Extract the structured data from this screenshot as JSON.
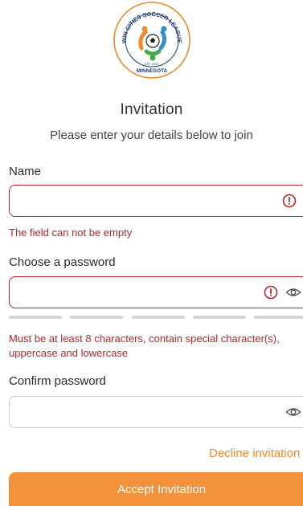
{
  "logo": {
    "top_text": "TWIN CITIES SOCCER LEAGUES",
    "est": "EST 2007",
    "bottom_text": "MINNESOTA"
  },
  "header": {
    "title": "Invitation",
    "subtitle": "Please enter your details below to join"
  },
  "form": {
    "name": {
      "label": "Name",
      "value": "",
      "error": "The field can not be empty"
    },
    "password": {
      "label": "Choose a password",
      "value": "",
      "error_line1": "Must be at least 8 characters, contain special character(s),",
      "error_line2": "uppercase and lowercase",
      "strength_segments": 5,
      "strength_filled": 0
    },
    "confirm": {
      "label": "Confirm password",
      "value": ""
    }
  },
  "actions": {
    "decline": "Decline invitation",
    "accept": "Accept Invitation"
  },
  "colors": {
    "error": "#b3262e",
    "accent": "#f4923b",
    "link": "#f08a2a"
  }
}
